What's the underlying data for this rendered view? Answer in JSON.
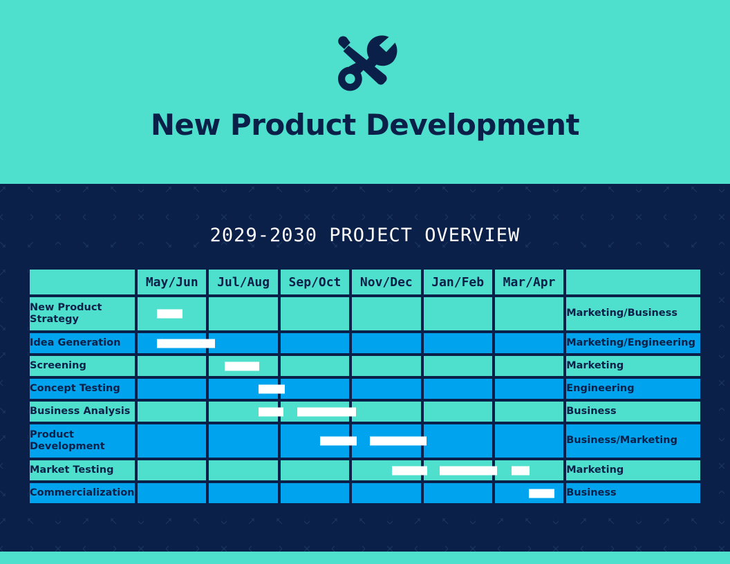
{
  "header": {
    "title": "New Product Development",
    "icon": "screwdriver-wrench-icon",
    "background_color": "#4ee0cd",
    "text_color": "#0b2048"
  },
  "section": {
    "title": "2029-2030 PROJECT OVERVIEW",
    "background_color": "#0b2048",
    "text_color": "#ffffff",
    "pattern": "x-cross-tile"
  },
  "footer": {
    "background_color": "#4ee0cd"
  },
  "palette": {
    "teal": "#4ee0cd",
    "blue": "#00a3ed",
    "navy": "#0b2048",
    "bar": "#ffffff"
  },
  "chart_data": {
    "type": "gantt",
    "title": "2029-2030 PROJECT OVERVIEW",
    "columns": [
      "",
      "May/Jun",
      "Jul/Aug",
      "Sep/Oct",
      "Nov/Dec",
      "Jan/Feb",
      "Mar/Apr",
      ""
    ],
    "periods": [
      "May/Jun",
      "Jul/Aug",
      "Sep/Oct",
      "Nov/Dec",
      "Jan/Feb",
      "Mar/Apr"
    ],
    "period_count": 6,
    "row_band_colors": [
      "teal",
      "blue",
      "teal",
      "blue",
      "teal",
      "blue",
      "teal",
      "blue"
    ],
    "tasks": [
      {
        "name": "New Product Strategy",
        "owner": "Marketing/Business",
        "band": "teal",
        "bars": [
          {
            "start_pct": 4.8,
            "width_pct": 6.0
          }
        ]
      },
      {
        "name": "Idea Generation",
        "owner": "Marketing/Engineering",
        "band": "blue",
        "bars": [
          {
            "start_pct": 4.8,
            "width_pct": 13.5
          }
        ]
      },
      {
        "name": "Screening",
        "owner": "Marketing",
        "band": "teal",
        "bars": [
          {
            "start_pct": 20.7,
            "width_pct": 8.0
          }
        ]
      },
      {
        "name": "Concept Testing",
        "owner": "Engineering",
        "band": "blue",
        "bars": [
          {
            "start_pct": 28.6,
            "width_pct": 6.0
          }
        ]
      },
      {
        "name": "Business Analysis",
        "owner": "Business",
        "band": "teal",
        "bars": [
          {
            "start_pct": 28.6,
            "width_pct": 5.8
          },
          {
            "start_pct": 37.6,
            "width_pct": 13.7
          }
        ]
      },
      {
        "name": "Product Development",
        "owner": "Business/Marketing",
        "band": "blue",
        "bars": [
          {
            "start_pct": 42.9,
            "width_pct": 8.5
          },
          {
            "start_pct": 54.5,
            "width_pct": 13.2
          }
        ]
      },
      {
        "name": "Market Testing",
        "owner": "Marketing",
        "band": "teal",
        "bars": [
          {
            "start_pct": 59.6,
            "width_pct": 8.2
          },
          {
            "start_pct": 70.7,
            "width_pct": 13.5
          },
          {
            "start_pct": 87.5,
            "width_pct": 4.2
          }
        ]
      },
      {
        "name": "Commercialization",
        "owner": "Business",
        "band": "blue",
        "bars": [
          {
            "start_pct": 91.6,
            "width_pct": 6.0
          }
        ]
      }
    ]
  }
}
